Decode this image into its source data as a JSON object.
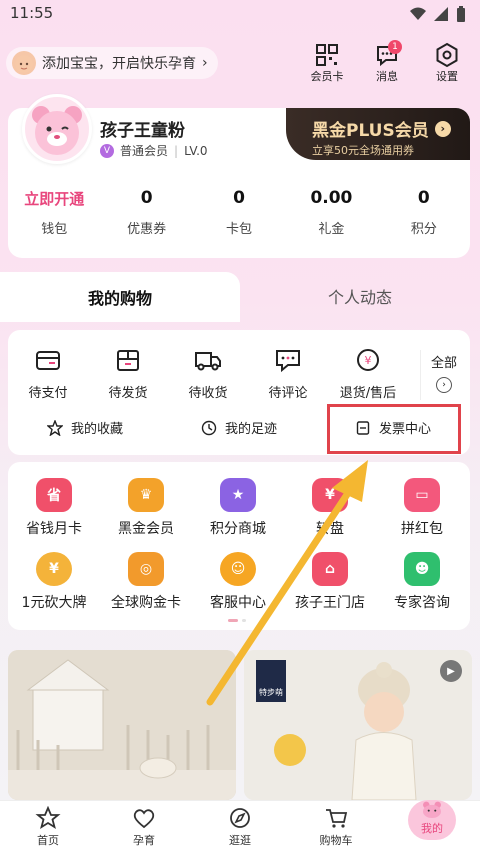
{
  "status_bar": {
    "time": "11:55"
  },
  "baby_prompt": {
    "label": "添加宝宝，开启快乐孕育"
  },
  "top_icons": [
    {
      "label": "会员卡",
      "icon": "qr-code-icon"
    },
    {
      "label": "消息",
      "icon": "message-icon",
      "badge": "1"
    },
    {
      "label": "设置",
      "icon": "settings-icon"
    }
  ],
  "profile": {
    "nickname": "孩子王童粉",
    "member_level": "普通会员",
    "level": "LV.0",
    "v_mark": "V"
  },
  "plus_banner": {
    "title": "黑金PLUS会员",
    "subtitle": "立享50元全场通用券"
  },
  "stats": [
    {
      "value": "立即开通",
      "label": "钱包"
    },
    {
      "value": "0",
      "label": "优惠券"
    },
    {
      "value": "0",
      "label": "卡包"
    },
    {
      "value": "0.00",
      "label": "礼金"
    },
    {
      "value": "0",
      "label": "积分"
    }
  ],
  "tabs": {
    "active": "我的购物",
    "inactive": "个人动态"
  },
  "orders": [
    {
      "label": "待支付",
      "icon": "wallet-icon"
    },
    {
      "label": "待发货",
      "icon": "package-icon"
    },
    {
      "label": "待收货",
      "icon": "truck-icon"
    },
    {
      "label": "待评论",
      "icon": "comment-icon"
    },
    {
      "label": "退货/售后",
      "icon": "refund-icon"
    }
  ],
  "orders_all": {
    "label": "全部"
  },
  "shortcuts": [
    {
      "label": "我的收藏",
      "icon": "star-icon"
    },
    {
      "label": "我的足迹",
      "icon": "clock-icon"
    },
    {
      "label": "发票中心",
      "icon": "invoice-icon"
    }
  ],
  "services_row1": [
    {
      "label": "省钱月卡",
      "color": "#f0506a",
      "glyph": "省"
    },
    {
      "label": "黑金会员",
      "color": "#f3a22a",
      "glyph": "♛"
    },
    {
      "label": "积分商城",
      "color": "#8b63e3",
      "glyph": "★"
    },
    {
      "label": "转盘",
      "color": "#f0506a",
      "glyph": "¥"
    },
    {
      "label": "拼红包",
      "color": "#f3587c",
      "glyph": "▭"
    }
  ],
  "services_row2": [
    {
      "label": "1元砍大牌",
      "color": "#f4b33a",
      "glyph": "¥"
    },
    {
      "label": "全球购金卡",
      "color": "#f29a2c",
      "glyph": "◎"
    },
    {
      "label": "客服中心",
      "color": "#f6a623",
      "glyph": "☺"
    },
    {
      "label": "孩子王门店",
      "color": "#f0506a",
      "glyph": "⌂"
    },
    {
      "label": "专家咨询",
      "color": "#2fbf6e",
      "glyph": "☻"
    }
  ],
  "banner_right": {
    "brand": "特步萌"
  },
  "bottom_nav": [
    {
      "label": "首页",
      "icon": "home-star-icon"
    },
    {
      "label": "孕育",
      "icon": "heart-icon"
    },
    {
      "label": "逛逛",
      "icon": "explore-icon"
    },
    {
      "label": "购物车",
      "icon": "cart-icon"
    },
    {
      "label": "我的",
      "icon": "bear-icon"
    }
  ],
  "colors": {
    "accent": "#e8467d",
    "highlight": "#e0434b",
    "arrow": "#f4b731"
  }
}
